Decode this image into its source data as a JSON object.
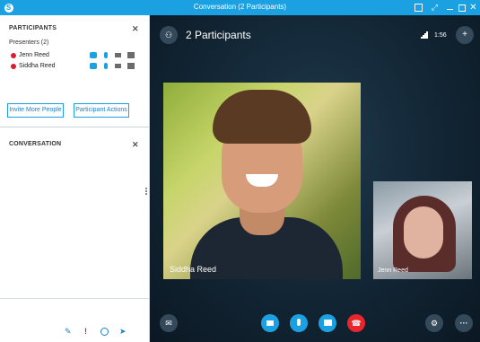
{
  "window": {
    "title": "Conversation (2 Participants)"
  },
  "participants_pane": {
    "heading": "PARTICIPANTS",
    "close": "✕",
    "presenters_label": "Presenters (2)",
    "people": [
      {
        "name": "Jenn Reed",
        "status": "busy"
      },
      {
        "name": "Siddha Reed",
        "status": "busy"
      }
    ],
    "invite_button": "Invite More People",
    "actions_button": "Participant Actions"
  },
  "conversation_pane": {
    "heading": "CONVERSATION",
    "close": "✕",
    "compose_icons": [
      "paperclip-icon",
      "importance-icon",
      "emoticon-icon",
      "send-icon"
    ]
  },
  "stage": {
    "participant_count": "2 Participants",
    "duration": "1:56",
    "main_video_name": "Siddha Reed",
    "small_video_name": "Jenn Reed",
    "controls": [
      "im-icon",
      "video-icon",
      "mic-icon",
      "present-icon",
      "hang-up-icon",
      "call-controls-icon",
      "more-options-icon"
    ]
  },
  "colors": {
    "accent": "#1ba1e2",
    "busy": "#d4202c",
    "hangup": "#e8262c",
    "stage_bg": "#122534"
  }
}
